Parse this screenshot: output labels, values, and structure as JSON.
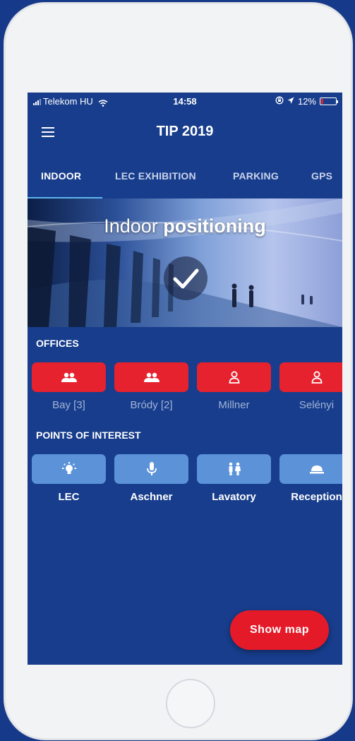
{
  "status_bar": {
    "carrier": "Telekom HU",
    "time": "14:58",
    "battery": "12%",
    "battery_level": 0.12,
    "icons": [
      "signal-icon",
      "wifi-icon",
      "rotation-lock-icon",
      "location-arrow-icon",
      "battery-icon"
    ]
  },
  "app_bar": {
    "title": "TIP 2019",
    "menu_icon": "menu-icon"
  },
  "tabs": [
    {
      "label": "INDOOR",
      "active": true
    },
    {
      "label": "LEC EXHIBITION",
      "active": false
    },
    {
      "label": "PARKING",
      "active": false
    },
    {
      "label": "GPS",
      "active": false
    }
  ],
  "hero": {
    "title_light": "Indoor",
    "title_bold": "positioning",
    "status_icon": "checkmark-icon"
  },
  "offices": {
    "title": "OFFICES",
    "items": [
      {
        "label": "Bay [3]",
        "icon": "people-icon"
      },
      {
        "label": "Bródy [2]",
        "icon": "people-icon"
      },
      {
        "label": "Millner",
        "icon": "person-icon"
      },
      {
        "label": "Selényi",
        "icon": "person-icon"
      }
    ]
  },
  "poi": {
    "title": "POINTS OF INTEREST",
    "items": [
      {
        "label": "LEC",
        "icon": "lightbulb-icon"
      },
      {
        "label": "Aschner",
        "icon": "microphone-icon"
      },
      {
        "label": "Lavatory",
        "icon": "restroom-icon"
      },
      {
        "label": "Reception",
        "icon": "service-bell-icon"
      }
    ]
  },
  "fab": {
    "label": "Show map"
  },
  "colors": {
    "background": "#17398a",
    "screen": "#173d8c",
    "accent_red": "#e5222e",
    "accent_light_blue": "#5b92d8",
    "tab_indicator": "#5fb5ef"
  }
}
